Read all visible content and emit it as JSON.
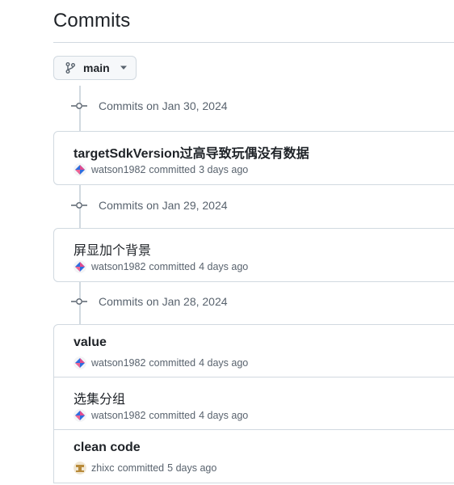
{
  "page": {
    "title": "Commits"
  },
  "branch": {
    "name": "main",
    "icon": "git-branch-icon"
  },
  "groups": [
    {
      "date_label": "Commits on Jan 30, 2024",
      "commits": [
        {
          "message": "targetSdkVersion过高导致玩偶没有数据",
          "author": "watson1982",
          "verb": "committed",
          "time": "3 days ago",
          "avatar": "diamond-avatar"
        }
      ]
    },
    {
      "date_label": "Commits on Jan 29, 2024",
      "commits": [
        {
          "message": "屏显加个背景",
          "author": "watson1982",
          "verb": "committed",
          "time": "4 days ago",
          "avatar": "diamond-avatar"
        }
      ]
    },
    {
      "date_label": "Commits on Jan 28, 2024",
      "commits": [
        {
          "message": "value",
          "author": "watson1982",
          "verb": "committed",
          "time": "4 days ago",
          "avatar": "diamond-avatar"
        },
        {
          "message": "选集分组",
          "author": "watson1982",
          "verb": "committed",
          "time": "4 days ago",
          "avatar": "diamond-avatar"
        },
        {
          "message": "clean code",
          "author": "zhixc",
          "verb": "committed",
          "time": "5 days ago",
          "avatar": "pixel-avatar"
        }
      ]
    }
  ],
  "colors": {
    "border": "#d1d9e0",
    "muted_text": "#59636e",
    "text": "#1f2328",
    "button_bg": "#f6f8fa"
  }
}
